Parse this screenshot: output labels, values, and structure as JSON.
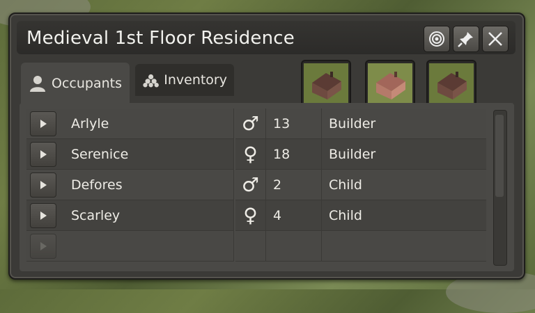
{
  "window": {
    "title": "Medieval  1st Floor Residence"
  },
  "title_buttons": [
    {
      "icon": "target-icon"
    },
    {
      "icon": "pin-icon"
    },
    {
      "icon": "close-icon"
    }
  ],
  "tabs": [
    {
      "label": "Occupants",
      "icon": "person-icon",
      "active": true
    },
    {
      "label": "Inventory",
      "icon": "stack-icon",
      "active": false
    }
  ],
  "house_variants": [
    {
      "icon": "house-dark-icon",
      "roof": "#5b3b34"
    },
    {
      "icon": "house-light-icon",
      "roof": "#a2665a"
    },
    {
      "icon": "house-dark-icon",
      "roof": "#5b3b34"
    }
  ],
  "occupants": [
    {
      "name": "Arlyle",
      "sex": "♂",
      "age": "13",
      "job": "Builder"
    },
    {
      "name": "Serenice",
      "sex": "♀",
      "age": "18",
      "job": "Builder"
    },
    {
      "name": "Defores",
      "sex": "♂",
      "age": "2",
      "job": "Child"
    },
    {
      "name": "Scarley",
      "sex": "♀",
      "age": "4",
      "job": "Child"
    },
    {
      "name": "",
      "sex": "",
      "age": "",
      "job": ""
    }
  ]
}
